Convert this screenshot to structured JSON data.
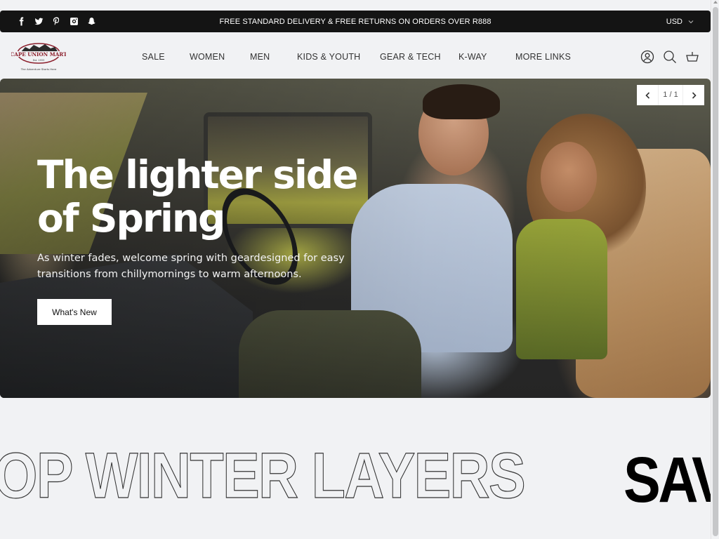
{
  "announcement": {
    "socials": [
      {
        "name": "facebook-icon",
        "label": "Facebook"
      },
      {
        "name": "twitter-icon",
        "label": "Twitter"
      },
      {
        "name": "pinterest-icon",
        "label": "Pinterest"
      },
      {
        "name": "instagram-icon",
        "label": "Instagram"
      },
      {
        "name": "snapchat-icon",
        "label": "Snapchat"
      }
    ],
    "text": "FREE STANDARD  DELIVERY &  FREE  RETURNS ON ORDERS OVER  R888",
    "currency": "USD"
  },
  "header": {
    "logo": {
      "brand": "CAPE UNION MART",
      "est": "Est. 1933",
      "tagline": "The Adventure Starts Here",
      "brand_color": "#8b1e2b"
    },
    "nav": [
      {
        "label": "SALE"
      },
      {
        "label": "WOMEN"
      },
      {
        "label": "MEN"
      },
      {
        "label": "KIDS & YOUTH"
      },
      {
        "label": "GEAR & TECH"
      },
      {
        "label": "K-WAY"
      },
      {
        "label": "MORE  LINKS"
      }
    ],
    "icons": [
      "account-icon",
      "search-icon",
      "cart-icon"
    ]
  },
  "hero": {
    "title": "The lighter side of Spring",
    "subtitle": "As winter fades, welcome spring with geardesigned for easy transitions from chillymornings to warm afternoons.",
    "cta": "What's New",
    "slide_counter": "1 / 1"
  },
  "marquee": {
    "outline_text": "OP WINTER LAYERS",
    "solid_text": "SAV"
  }
}
